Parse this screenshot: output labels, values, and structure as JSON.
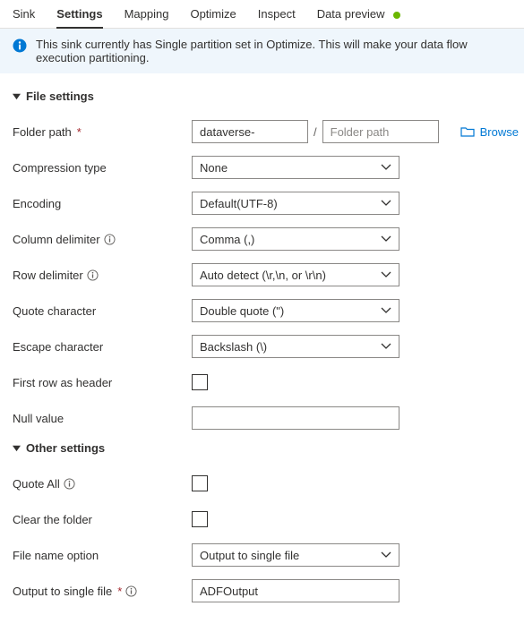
{
  "tabs": {
    "sink": "Sink",
    "settings": "Settings",
    "mapping": "Mapping",
    "optimize": "Optimize",
    "inspect": "Inspect",
    "data_preview": "Data preview"
  },
  "banner": {
    "text": "This sink currently has Single partition set in Optimize. This will make your data flow execution partitioning."
  },
  "sections": {
    "file_settings": "File settings",
    "other_settings": "Other settings"
  },
  "labels": {
    "folder_path": "Folder path",
    "compression_type": "Compression type",
    "encoding": "Encoding",
    "column_delimiter": "Column delimiter",
    "row_delimiter": "Row delimiter",
    "quote_character": "Quote character",
    "escape_character": "Escape character",
    "first_row_header": "First row as header",
    "null_value": "Null value",
    "quote_all": "Quote All",
    "clear_folder": "Clear the folder",
    "file_name_option": "File name option",
    "output_single_file": "Output to single file"
  },
  "values": {
    "folder_path_a": "dataverse-",
    "folder_path_b_placeholder": "Folder path",
    "compression_type": "None",
    "encoding": "Default(UTF-8)",
    "column_delimiter": "Comma (,)",
    "row_delimiter": "Auto detect (\\r,\\n, or \\r\\n)",
    "quote_character": "Double quote (\")",
    "escape_character": "Backslash (\\)",
    "null_value": "",
    "file_name_option": "Output to single file",
    "output_single_file": "ADFOutput"
  },
  "actions": {
    "browse": "Browse"
  }
}
